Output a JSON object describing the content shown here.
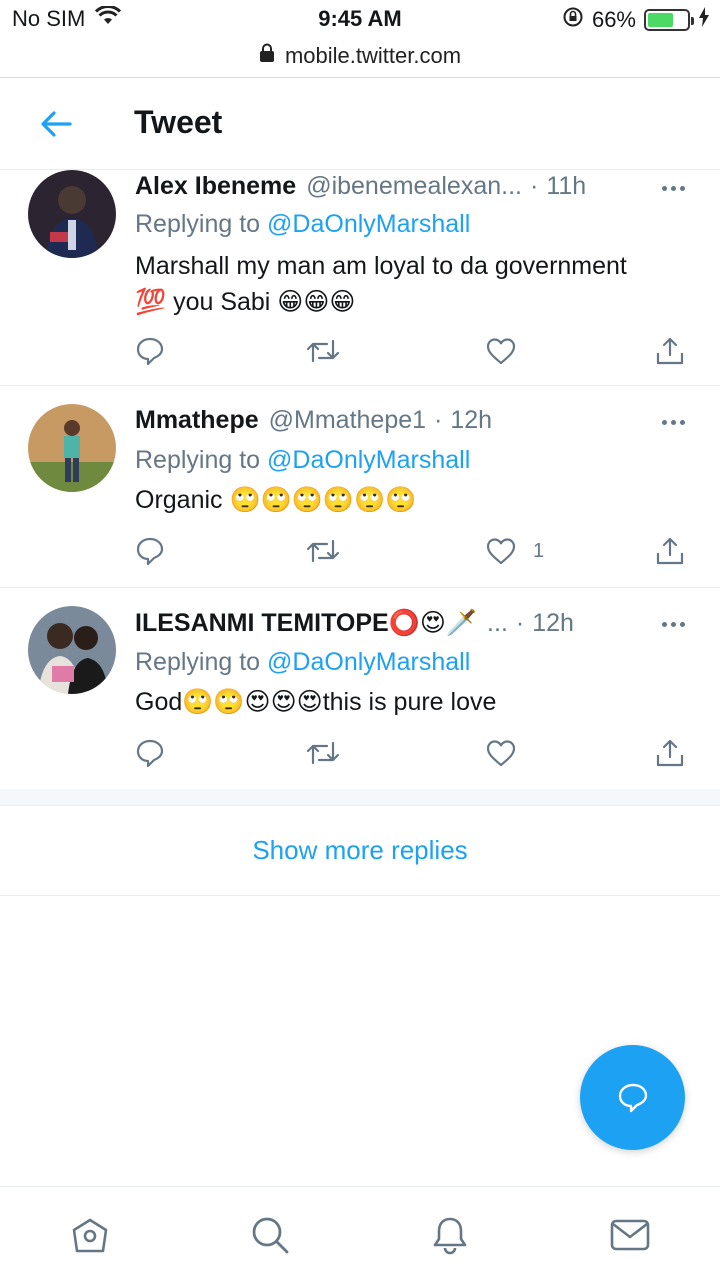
{
  "status_bar": {
    "carrier": "No SIM",
    "time": "9:45 AM",
    "battery": "66%",
    "battery_fraction": 0.66,
    "url": "mobile.twitter.com"
  },
  "header": {
    "title": "Tweet"
  },
  "tweets": [
    {
      "name": "Alex Ibeneme",
      "handle": "@ibenemealexan...",
      "time": "11h",
      "replying_prefix": "Replying to ",
      "replying_to": "@DaOnlyMarshall",
      "text_line1": "Marshall my man am loyal to da government",
      "text_line2": "💯 you Sabi 😁😁😁",
      "like_count": ""
    },
    {
      "name": "Mmathepe",
      "handle": "@Mmathepe1",
      "time": "12h",
      "replying_prefix": "Replying to ",
      "replying_to": "@DaOnlyMarshall",
      "text_line1": "Organic 🙄🙄🙄🙄🙄🙄",
      "like_count": "1"
    },
    {
      "name": "ILESANMI TEMITOPE⭕😍🗡️",
      "handle": "...",
      "time": "12h",
      "replying_prefix": "Replying to ",
      "replying_to": "@DaOnlyMarshall",
      "text_line1": "God🙄🙄😍😍😍this is pure love",
      "like_count": ""
    }
  ],
  "show_more": "Show more replies",
  "icons": [
    "back-arrow-icon",
    "lock-icon",
    "wifi-icon",
    "reply-icon",
    "retweet-icon",
    "like-icon",
    "share-icon",
    "more-icon",
    "compose-icon",
    "home-icon",
    "search-icon",
    "notifications-icon",
    "messages-icon"
  ],
  "colors": {
    "accent": "#1da1f2",
    "secondary_text": "#657786",
    "divider": "#e6ecf0"
  }
}
